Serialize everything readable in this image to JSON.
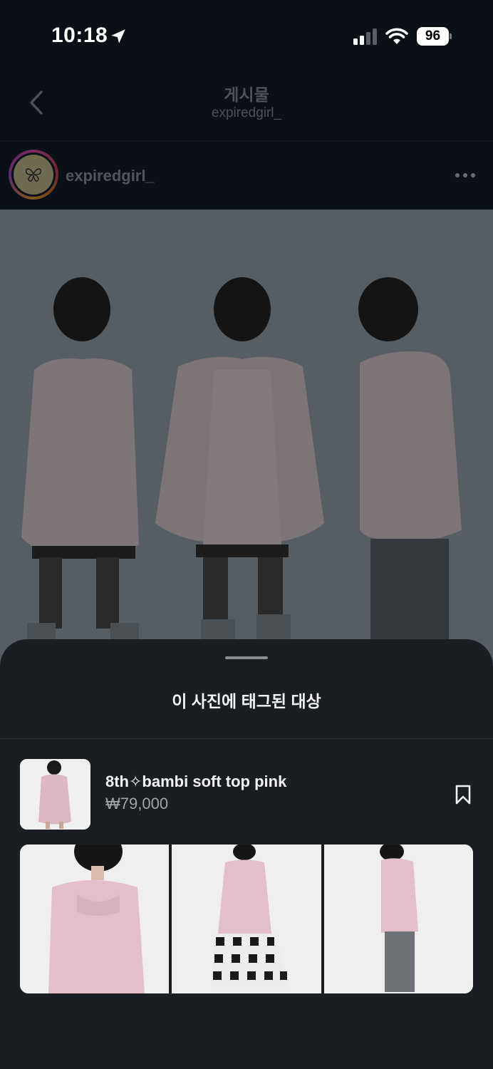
{
  "status_bar": {
    "time": "10:18",
    "battery": "96",
    "icons": [
      "location-arrow-icon",
      "signal-icon",
      "wifi-icon",
      "battery-icon"
    ]
  },
  "header": {
    "title": "게시물",
    "subtitle": "expiredgirl_",
    "back_icon": "chevron-left-icon"
  },
  "post": {
    "author": "expiredgirl_",
    "more_icon": "ellipsis-icon"
  },
  "sheet": {
    "title": "이 사진에 태그된 대상",
    "product": {
      "name": "8th✧bambi soft top pink",
      "price": "₩79,000",
      "bookmark_icon": "bookmark-icon"
    }
  },
  "colors": {
    "background": "#0b0f16",
    "sheet": "#1a1e23",
    "dim_text": "#4d525a",
    "price_text": "#a1a4a9",
    "photo_dim": "#565d63"
  }
}
